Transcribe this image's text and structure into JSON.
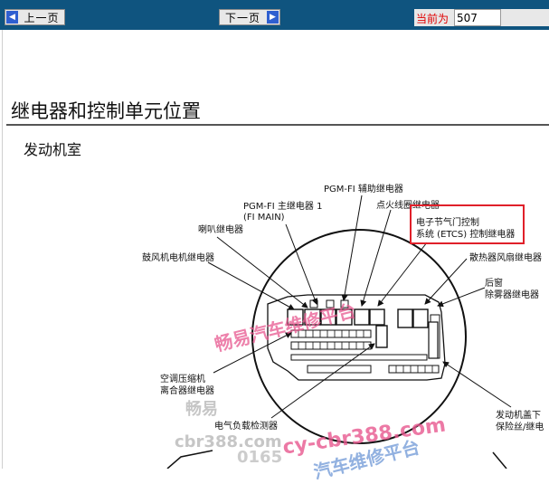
{
  "toolbar": {
    "prev_label": "上一页",
    "next_label": "下一页",
    "current_label": "当前为",
    "current_page": "507"
  },
  "page": {
    "title": "继电器和控制单元位置",
    "subtitle": "发动机室"
  },
  "labels": {
    "pgm_fi_aux": "PGM-FI 辅助继电器",
    "pgm_fi_main_1": "PGM-FI 主继电器 1",
    "pgm_fi_main_2": "(FI MAIN)",
    "ignition_coil": "点火线圈继电器",
    "horn": "喇叭继电器",
    "etcs_1": "电子节气门控制",
    "etcs_2": "系统 (ETCS) 控制继电器",
    "blower": "鼓风机电机继电器",
    "radiator_fan": "散热器风扇继电器",
    "rear_window_1": "后窗",
    "rear_window_2": "除雾器继电器",
    "ac_clutch_1": "空调压缩机",
    "ac_clutch_2": "离合器继电器",
    "elec_load": "电气负载检测器",
    "under_hood_1": "发动机盖下",
    "under_hood_2": "保险丝/继电"
  },
  "watermarks": {
    "w1": "畅易汽车维修平台",
    "w2": "畅易",
    "w3": "cbr388.com",
    "w4": "cy-cbr388.com",
    "w5": "0165",
    "w6": "汽车维修平台"
  },
  "colors": {
    "toolbar_bg": "#0f547f",
    "highlight_box": "#e0202a",
    "watermark_pink": "#e8588f"
  }
}
